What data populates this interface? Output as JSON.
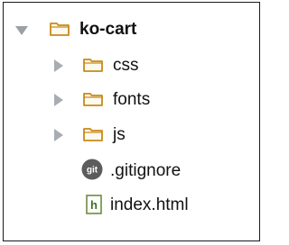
{
  "project_tree": {
    "root": {
      "label": "ko-cart",
      "expanded": true,
      "icon": "folder-icon"
    },
    "children": [
      {
        "type": "folder",
        "label": "css",
        "expanded": false,
        "icon": "folder-icon"
      },
      {
        "type": "folder",
        "label": "fonts",
        "expanded": false,
        "icon": "folder-icon"
      },
      {
        "type": "folder",
        "label": "js",
        "expanded": false,
        "icon": "folder-icon"
      },
      {
        "type": "file",
        "label": ".gitignore",
        "icon": "git-file-icon",
        "icon_text": "git"
      },
      {
        "type": "file",
        "label": "index.html",
        "icon": "html-file-icon",
        "icon_text": "h"
      }
    ]
  },
  "colors": {
    "folder_outline": "#c78a1a",
    "folder_fill": "#fffaf0",
    "arrow": "#a8adb2",
    "git_icon": "#5c5c5c",
    "html_icon_border": "#6d8b3f",
    "html_icon_letter": "#3f6e2a"
  }
}
